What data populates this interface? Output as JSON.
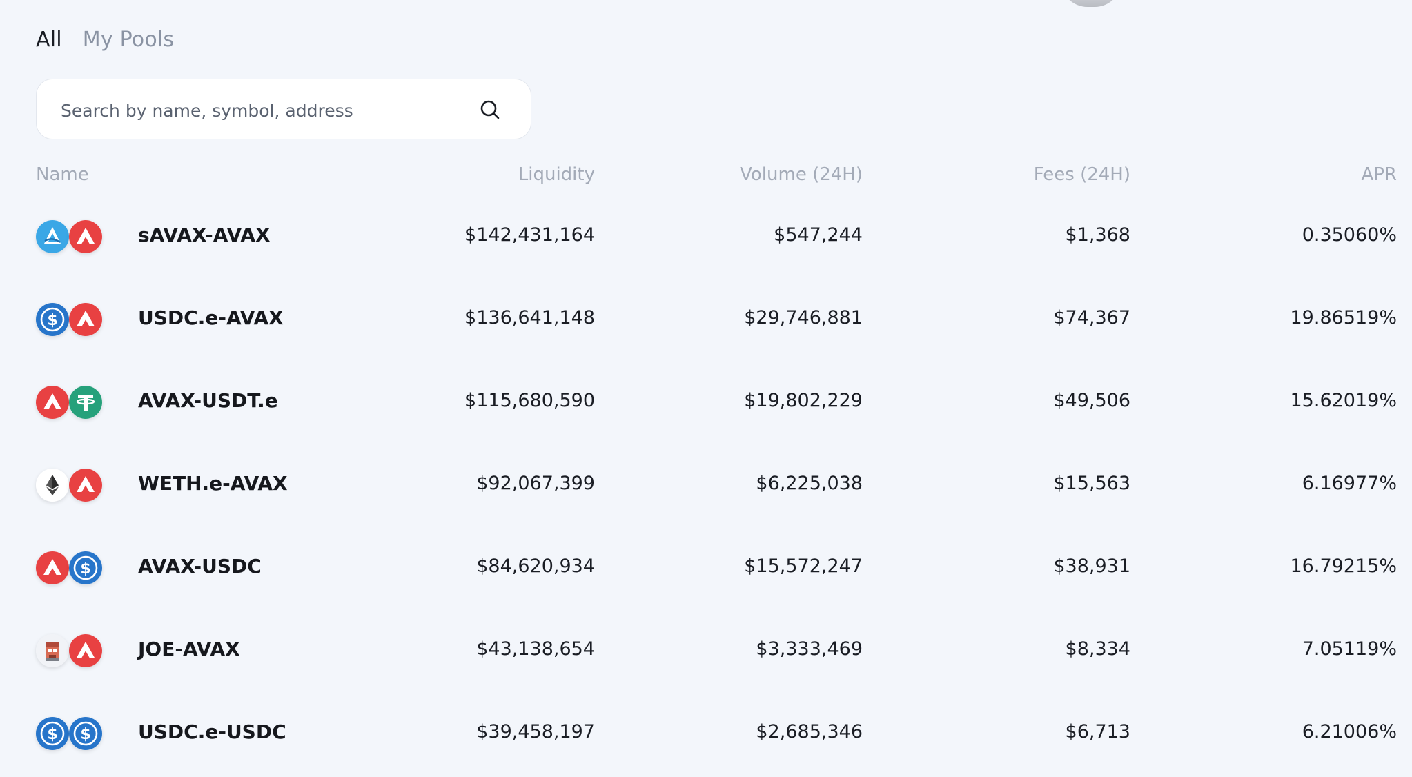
{
  "tabs": [
    {
      "label": "All",
      "active": true
    },
    {
      "label": "My Pools",
      "active": false
    }
  ],
  "search": {
    "placeholder": "Search by name, symbol, address",
    "value": ""
  },
  "table": {
    "headers": {
      "name": "Name",
      "liquidity": "Liquidity",
      "volume": "Volume (24H)",
      "fees": "Fees (24H)",
      "apr": "APR"
    },
    "rows": [
      {
        "name": "sAVAX-AVAX",
        "liquidity": "$142,431,164",
        "volume": "$547,244",
        "fees": "$1,368",
        "apr": "0.35060%",
        "tokens": [
          "savax-icon",
          "avax-icon"
        ]
      },
      {
        "name": "USDC.e-AVAX",
        "liquidity": "$136,641,148",
        "volume": "$29,746,881",
        "fees": "$74,367",
        "apr": "19.86519%",
        "tokens": [
          "usdc-icon",
          "avax-icon"
        ]
      },
      {
        "name": "AVAX-USDT.e",
        "liquidity": "$115,680,590",
        "volume": "$19,802,229",
        "fees": "$49,506",
        "apr": "15.62019%",
        "tokens": [
          "avax-icon",
          "usdt-icon"
        ]
      },
      {
        "name": "WETH.e-AVAX",
        "liquidity": "$92,067,399",
        "volume": "$6,225,038",
        "fees": "$15,563",
        "apr": "6.16977%",
        "tokens": [
          "eth-icon",
          "avax-icon"
        ]
      },
      {
        "name": "AVAX-USDC",
        "liquidity": "$84,620,934",
        "volume": "$15,572,247",
        "fees": "$38,931",
        "apr": "16.79215%",
        "tokens": [
          "avax-icon",
          "usdc-icon"
        ]
      },
      {
        "name": "JOE-AVAX",
        "liquidity": "$43,138,654",
        "volume": "$3,333,469",
        "fees": "$8,334",
        "apr": "7.05119%",
        "tokens": [
          "joe-icon",
          "avax-icon"
        ]
      },
      {
        "name": "USDC.e-USDC",
        "liquidity": "$39,458,197",
        "volume": "$2,685,346",
        "fees": "$6,713",
        "apr": "6.21006%",
        "tokens": [
          "usdc-icon",
          "usdc-icon"
        ]
      }
    ]
  },
  "colors": {
    "background": "#f3f6fb",
    "avax": "#e84142",
    "usdc": "#2775ca",
    "usdt": "#26a17b",
    "savax": "#3aa7e6"
  }
}
